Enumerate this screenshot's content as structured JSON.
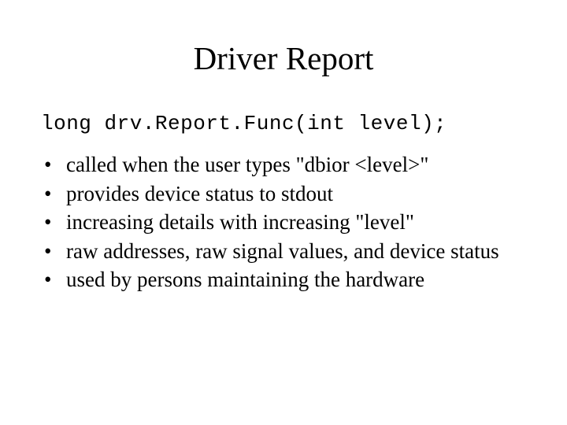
{
  "title": "Driver Report",
  "code_line": "long    drv.Report.Func(int level);",
  "bullets": [
    "called when the user types \"dbior <level>\"",
    "provides device status to stdout",
    "increasing details with increasing \"level\"",
    "raw addresses, raw signal values, and device status",
    "used by persons maintaining the hardware"
  ]
}
